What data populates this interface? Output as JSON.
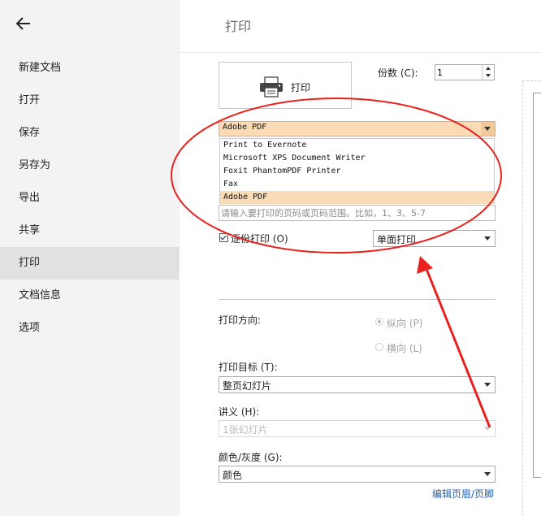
{
  "sidebar": {
    "items": [
      {
        "label": "新建文档"
      },
      {
        "label": "打开"
      },
      {
        "label": "保存"
      },
      {
        "label": "另存为"
      },
      {
        "label": "导出"
      },
      {
        "label": "共享"
      },
      {
        "label": "打印",
        "active": true
      },
      {
        "label": "文档信息"
      },
      {
        "label": "选项"
      }
    ]
  },
  "main": {
    "title": "打印",
    "print_button": {
      "label": "打印",
      "icon": "printer-icon"
    },
    "copies": {
      "label": "份数 (C):",
      "value": "1"
    },
    "printer": {
      "selected": "Adobe PDF",
      "options": [
        "Print to Evernote",
        "Microsoft XPS Document Writer",
        "Foxit PhantomPDF Printer",
        "Fax",
        "Adobe PDF"
      ]
    },
    "page_range": {
      "placeholder": "请输入要打印的页码或页码范围。比如，1、3、5-7"
    },
    "collate": {
      "label": "逐份打印  (O)",
      "checked": true
    },
    "duplex": {
      "value": "单面打印"
    },
    "orientation": {
      "label": "打印方向:",
      "portrait": "纵向  (P)",
      "landscape": "横向  (L)",
      "selected": "portrait"
    },
    "print_target": {
      "label": "打印目标  (T):",
      "value": "整页幻灯片"
    },
    "handout": {
      "label": "讲义  (H):",
      "value": "1张幻灯片",
      "disabled": true
    },
    "color": {
      "label": "颜色/灰度  (G):",
      "value": "颜色"
    },
    "header_footer_link": "编辑页眉/页脚"
  },
  "colors": {
    "selection": "#fbdbb6",
    "sidebar_bg": "#f3f3f3",
    "sidebar_active": "#e1e1e1",
    "annotation": "#e8231f",
    "link": "#1f5fb0"
  }
}
